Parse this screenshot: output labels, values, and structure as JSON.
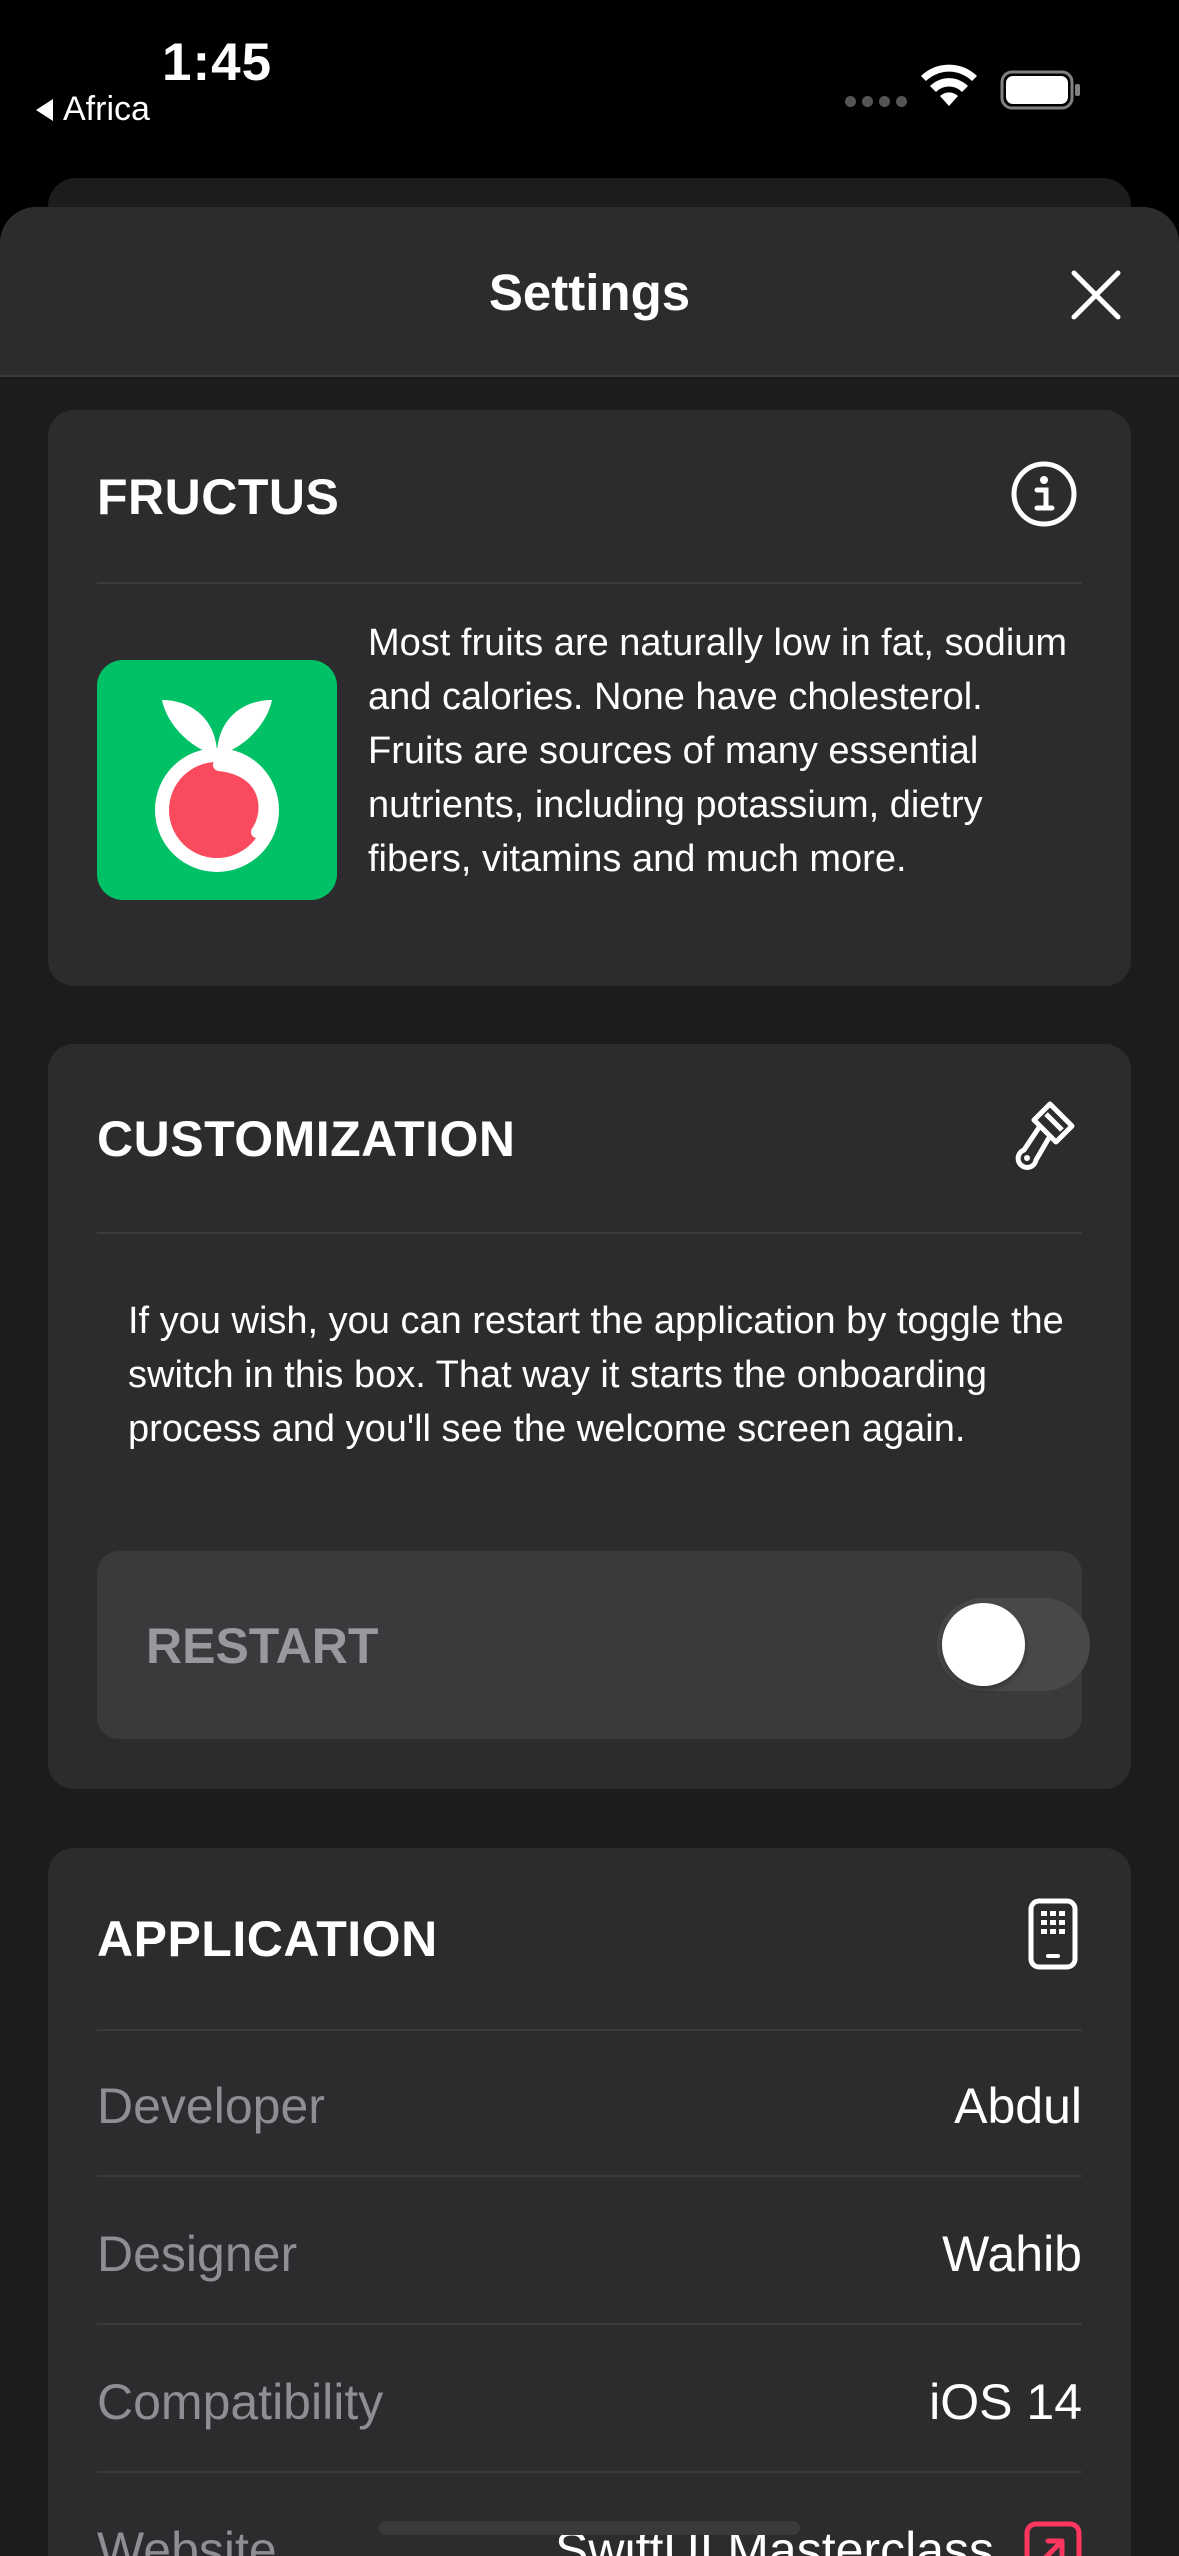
{
  "status_bar": {
    "time": "1:45",
    "back_app": "Africa"
  },
  "nav": {
    "title": "Settings"
  },
  "fructus": {
    "title": "FRUCTUS",
    "description": "Most fruits are naturally low in fat, sodium and calories. None have cholesterol. Fruits are sources of many essential nutrients, including potassium, dietry fibers, vitamins and much more.",
    "icon_color": "#00c165"
  },
  "customization": {
    "title": "CUSTOMIZATION",
    "description": "If you wish, you can restart the application by toggle the switch in this box. That way it starts the onboarding process and you'll see the welcome screen again.",
    "restart_label": "RESTART",
    "restart_on": false
  },
  "application": {
    "title": "APPLICATION",
    "rows": [
      {
        "label": "Developer",
        "value": "Abdul"
      },
      {
        "label": "Designer",
        "value": "Wahib"
      },
      {
        "label": "Compatibility",
        "value": "iOS 14"
      },
      {
        "label": "Website",
        "value": "SwiftUI Masterclass"
      }
    ]
  },
  "colors": {
    "accent_link": "#ff375f",
    "card_bg": "#2c2c2e",
    "sheet_bg": "#1c1c1e"
  }
}
